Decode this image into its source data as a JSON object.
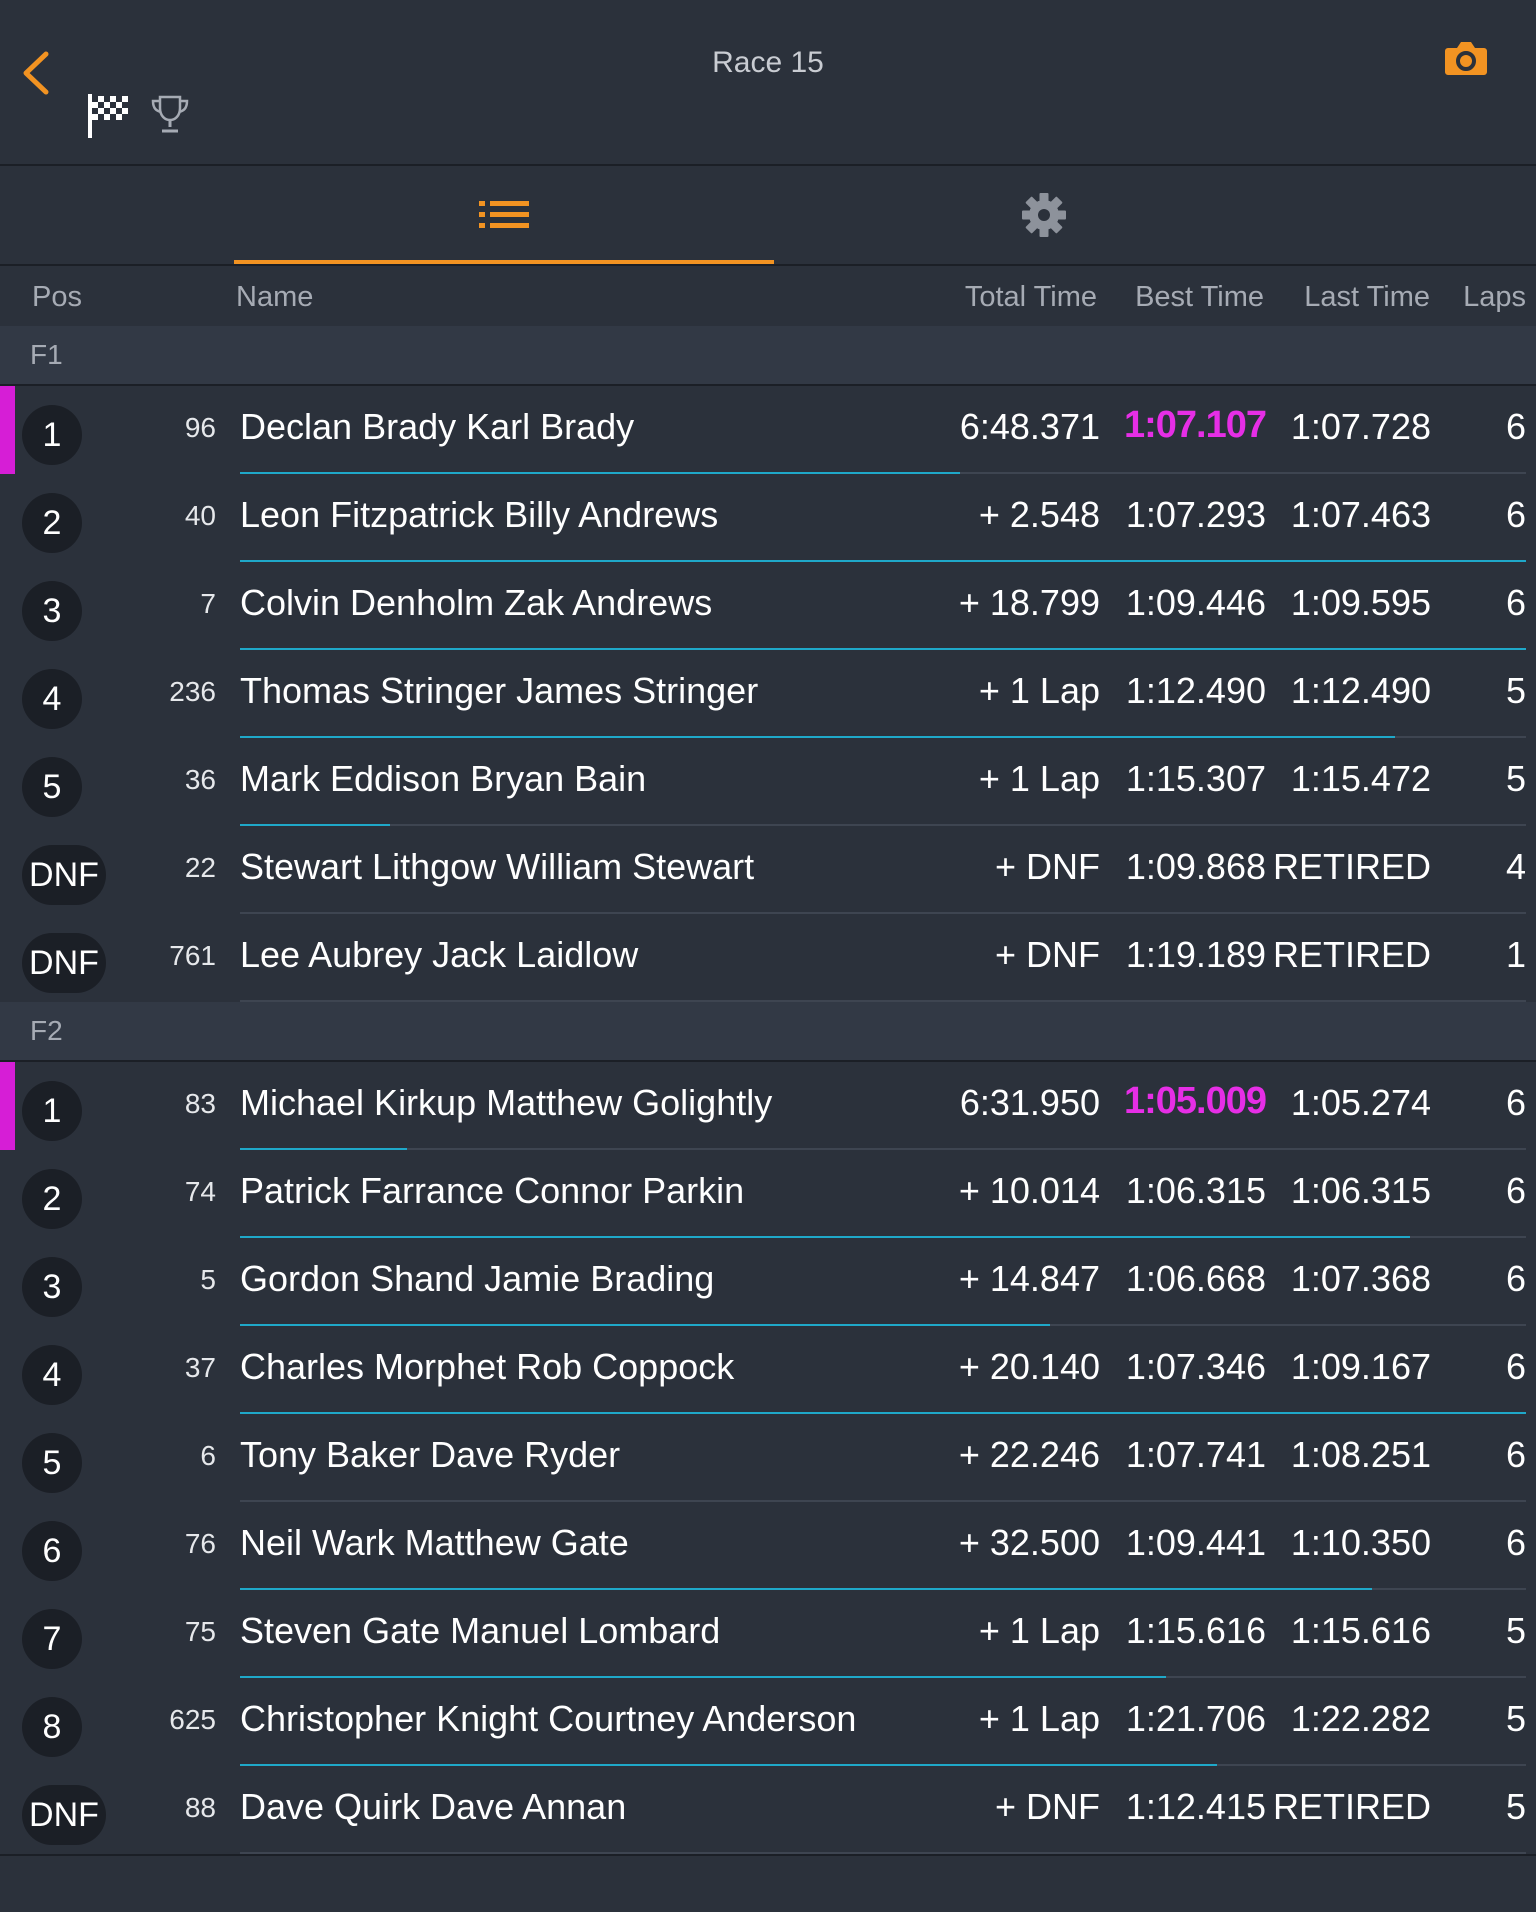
{
  "header": {
    "title": "Race 15"
  },
  "columns": {
    "pos": "Pos",
    "name": "Name",
    "total": "Total Time",
    "best": "Best Time",
    "last": "Last Time",
    "laps": "Laps"
  },
  "colors": {
    "accent": "#f29322",
    "fastest": "#e62ee6",
    "progress": "#1fa8c9",
    "background": "#2b313b"
  },
  "icons": [
    "back-chevron-icon",
    "checkered-flag-icon",
    "trophy-icon",
    "camera-icon",
    "list-icon",
    "gear-icon"
  ],
  "groups": [
    {
      "label": "F1",
      "rows": [
        {
          "pos": "1",
          "num": "96",
          "name": "Declan Brady Karl Brady",
          "total": "6:48.371",
          "best": "1:07.107",
          "last": "1:07.728",
          "laps": "6",
          "leader": true,
          "fastest": true,
          "progress": 0.56
        },
        {
          "pos": "2",
          "num": "40",
          "name": "Leon Fitzpatrick Billy Andrews",
          "total": "+ 2.548",
          "best": "1:07.293",
          "last": "1:07.463",
          "laps": "6",
          "progress": 1.0
        },
        {
          "pos": "3",
          "num": "7",
          "name": "Colvin Denholm Zak Andrews",
          "total": "+ 18.799",
          "best": "1:09.446",
          "last": "1:09.595",
          "laps": "6",
          "progress": 1.0
        },
        {
          "pos": "4",
          "num": "236",
          "name": "Thomas Stringer James Stringer",
          "total": "+ 1 Lap",
          "best": "1:12.490",
          "last": "1:12.490",
          "laps": "5",
          "progress": 0.898
        },
        {
          "pos": "5",
          "num": "36",
          "name": "Mark Eddison Bryan Bain",
          "total": "+ 1 Lap",
          "best": "1:15.307",
          "last": "1:15.472",
          "laps": "5",
          "progress": 0.117
        },
        {
          "pos": "DNF",
          "num": "22",
          "name": "Stewart Lithgow William Stewart",
          "total": "+ DNF",
          "best": "1:09.868",
          "last": "RETIRED",
          "laps": "4",
          "progress": 0
        },
        {
          "pos": "DNF",
          "num": "761",
          "name": "Lee Aubrey Jack Laidlow",
          "total": "+ DNF",
          "best": "1:19.189",
          "last": "RETIRED",
          "laps": "1",
          "progress": 0
        }
      ]
    },
    {
      "label": "F2",
      "rows": [
        {
          "pos": "1",
          "num": "83",
          "name": "Michael Kirkup Matthew Golightly",
          "total": "6:31.950",
          "best": "1:05.009",
          "last": "1:05.274",
          "laps": "6",
          "leader": true,
          "fastest": true,
          "progress": 0.13
        },
        {
          "pos": "2",
          "num": "74",
          "name": "Patrick Farrance Connor Parkin",
          "total": "+ 10.014",
          "best": "1:06.315",
          "last": "1:06.315",
          "laps": "6",
          "progress": 0.91
        },
        {
          "pos": "3",
          "num": "5",
          "name": "Gordon Shand Jamie Brading",
          "total": "+ 14.847",
          "best": "1:06.668",
          "last": "1:07.368",
          "laps": "6",
          "progress": 0.63
        },
        {
          "pos": "4",
          "num": "37",
          "name": "Charles Morphet Rob Coppock",
          "total": "+ 20.140",
          "best": "1:07.346",
          "last": "1:09.167",
          "laps": "6",
          "progress": 1.0
        },
        {
          "pos": "5",
          "num": "6",
          "name": "Tony Baker Dave Ryder",
          "total": "+ 22.246",
          "best": "1:07.741",
          "last": "1:08.251",
          "laps": "6",
          "progress": 0
        },
        {
          "pos": "6",
          "num": "76",
          "name": "Neil Wark Matthew Gate",
          "total": "+ 32.500",
          "best": "1:09.441",
          "last": "1:10.350",
          "laps": "6",
          "progress": 0.88
        },
        {
          "pos": "7",
          "num": "75",
          "name": "Steven Gate Manuel Lombard",
          "total": "+ 1 Lap",
          "best": "1:15.616",
          "last": "1:15.616",
          "laps": "5",
          "progress": 0.72
        },
        {
          "pos": "8",
          "num": "625",
          "name": "Christopher Knight Courtney Anderson",
          "total": "+ 1 Lap",
          "best": "1:21.706",
          "last": "1:22.282",
          "laps": "5",
          "progress": 0.76
        },
        {
          "pos": "DNF",
          "num": "88",
          "name": "Dave Quirk Dave Annan",
          "total": "+ DNF",
          "best": "1:12.415",
          "last": "RETIRED",
          "laps": "5",
          "progress": 0
        }
      ]
    }
  ]
}
